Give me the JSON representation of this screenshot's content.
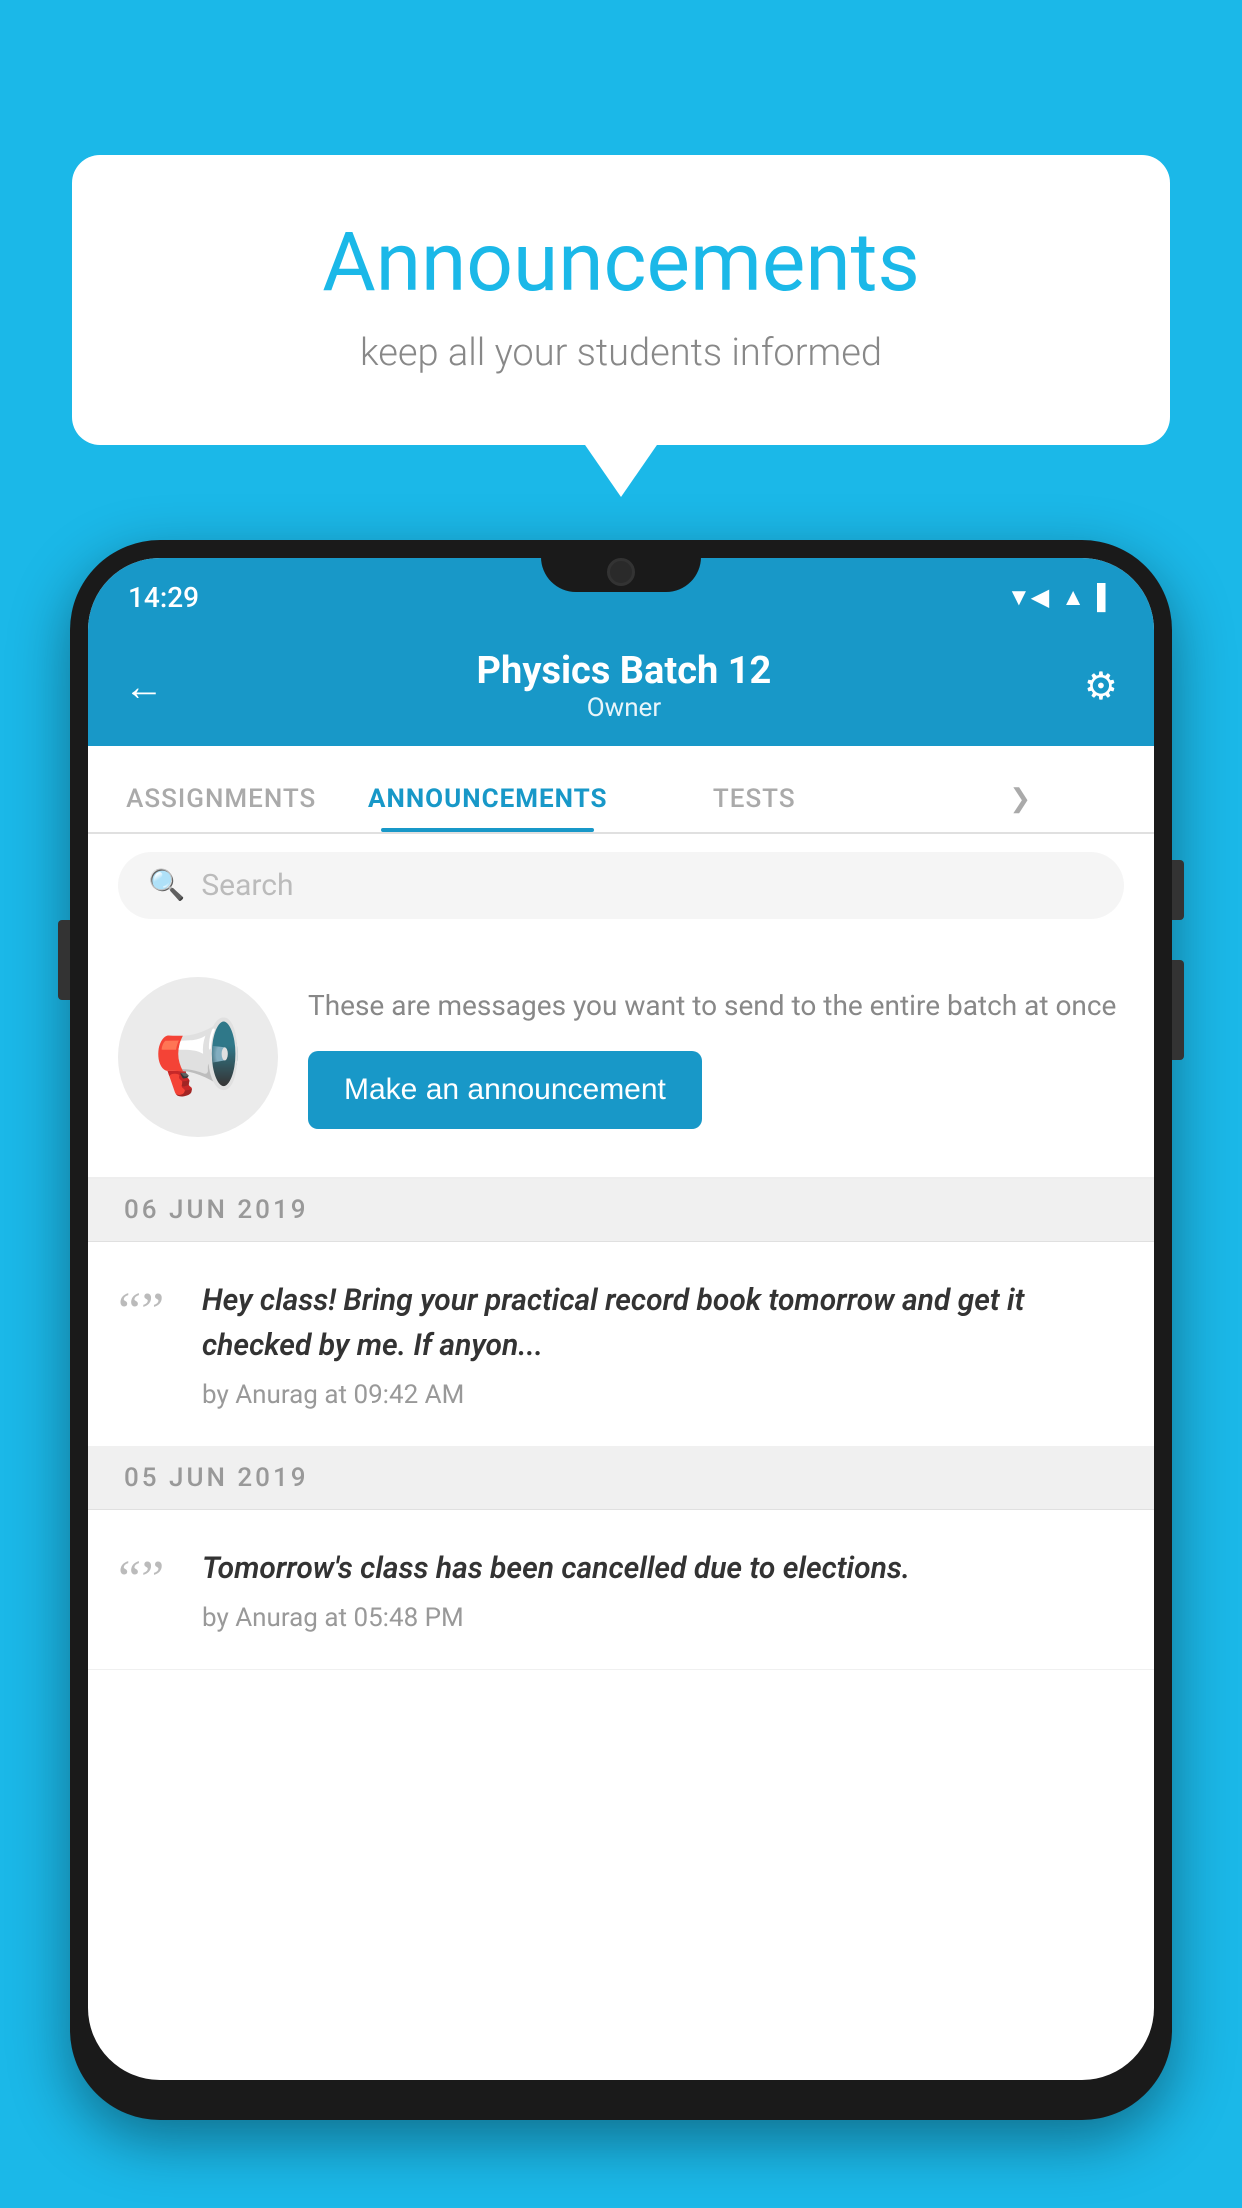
{
  "background_color": "#1BB8E8",
  "speech_bubble": {
    "title": "Announcements",
    "subtitle": "keep all your students informed"
  },
  "phone": {
    "status_bar": {
      "time": "14:29",
      "icons": [
        "wifi",
        "signal",
        "battery"
      ]
    },
    "header": {
      "title": "Physics Batch 12",
      "subtitle": "Owner",
      "back_label": "←",
      "settings_label": "⚙"
    },
    "tabs": [
      {
        "label": "ASSIGNMENTS",
        "active": false
      },
      {
        "label": "ANNOUNCEMENTS",
        "active": true
      },
      {
        "label": "TESTS",
        "active": false
      },
      {
        "label": "...",
        "active": false
      }
    ],
    "search": {
      "placeholder": "Search"
    },
    "promo_card": {
      "description": "These are messages you want to send to the entire batch at once",
      "button_label": "Make an announcement"
    },
    "announcements": [
      {
        "date": "06  JUN  2019",
        "text": "Hey class! Bring your practical record book tomorrow and get it checked by me. If anyon...",
        "meta": "by Anurag at 09:42 AM"
      },
      {
        "date": "05  JUN  2019",
        "text": "Tomorrow's class has been cancelled due to elections.",
        "meta": "by Anurag at 05:48 PM"
      }
    ]
  }
}
